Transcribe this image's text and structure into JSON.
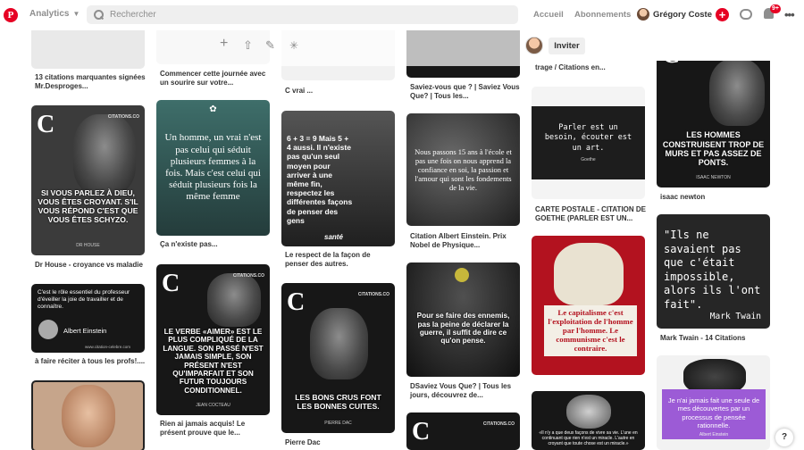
{
  "header": {
    "logo": "P",
    "analytics_label": "Analytics",
    "search_placeholder": "Rechercher",
    "nav_home": "Accueil",
    "nav_following": "Abonnements",
    "user_name": "Grégory Coste",
    "notification_badge": "9+",
    "more": "•••"
  },
  "toolbar": {
    "invite_label": "Inviter"
  },
  "colors": {
    "brand_red": "#e60023",
    "header_grey": "#efefef"
  },
  "pins": {
    "col1": [
      {
        "caption": "13 citations marquantes signées Mr.Desproges..."
      },
      {
        "quote": "Si vous parlez à Dieu, vous êtes croyant. S'il vous répond c'est que vous êtes schyzo.",
        "logo": "C",
        "site": "CITATIONS.CO",
        "author": "DR HOUSE",
        "caption": "Dr House - croyance vs maladie"
      },
      {
        "quote": "C'est le rôle essentiel du professeur d'éveiller la joie de travailler et de connaître.",
        "author": "Albert Einstein",
        "site": "www.citation-celebre.com",
        "caption": "à faire réciter à tous les profs!...."
      }
    ],
    "col2": [
      {
        "caption": "Commencer cette journée avec un sourire sur votre..."
      },
      {
        "quote": "Un homme, un vrai n'est pas celui qui séduit plusieurs femmes à la fois. Mais c'est celui qui séduit plusieurs fois la même femme",
        "caption": "Ça n'existe pas..."
      },
      {
        "quote": "Le verbe «aimer» est le plus compliqué de la langue. Son passé n'est jamais simple, son présent n'est qu'imparfait et son futur toujours conditionnel.",
        "logo": "C",
        "site": "CITATIONS.CO",
        "author": "JEAN COCTEAU",
        "caption": "Rien ai jamais acquis! Le présent prouve que le..."
      }
    ],
    "col3": [
      {
        "caption": "C vrai ..."
      },
      {
        "quote": "6 + 3 = 9 Mais 5 + 4 aussi. Il n'existe pas qu'un seul moyen pour arriver à une même fin, respectez les différentes façons de penser des gens",
        "brand": "santé",
        "caption": "Le respect de la façon de penser des autres."
      },
      {
        "quote": "Les bons crus font les bonnes cuites.",
        "logo": "C",
        "site": "CITATIONS.CO",
        "author": "PIERRE DAC",
        "caption": "Pierre Dac"
      }
    ],
    "col4": [
      {
        "caption": "Saviez-vous que ? | Saviez Vous Que? | Tous les..."
      },
      {
        "quote": "Nous passons 15 ans à l'école et pas une fois on nous apprend la confiance en soi, la passion et l'amour qui sont les fondements de la vie.",
        "caption": "Citation Albert Einstein. Prix Nobel de Physique..."
      },
      {
        "quote": "Pour se faire des ennemis, pas la peine de déclarer la guerre, il suffit de dire ce qu'on pense.",
        "caption": "DSaviez Vous Que? | Tous les jours, découvrez de..."
      },
      {
        "logo": "C",
        "site": "CITATIONS.CO"
      }
    ],
    "col5": [
      {
        "caption": "trage / Citations en..."
      },
      {
        "quote": "Parler est un besoin, écouter est un art.",
        "author": "Goethe",
        "caption": "CARTE POSTALE - CITATION DE GOETHE (PARLER EST UN..."
      },
      {
        "quote": "Le capitalisme c'est l'exploitation de l'homme par l'homme. Le communisme c'est le contraire."
      },
      {
        "quote": "«Il n'y a que deux façons de vivre sa vie. L'une en continuant que rien n'est un miracle. L'autre en croyant que toute chose est un miracle.»"
      }
    ],
    "col6": [
      {
        "quote": "Les hommes construisent trop de murs et pas assez de ponts.",
        "logo": "C",
        "author": "ISAAC NEWTON",
        "caption": "isaac newton"
      },
      {
        "quote": "\"Ils ne savaient pas que c'était impossible, alors ils l'ont fait\".",
        "author": "Mark Twain",
        "caption": "Mark Twain - 14 Citations"
      },
      {
        "quote": "Je n'ai jamais fait une seule de mes découvertes par un processus de pensée rationnelle.",
        "author": "Albert Einstein"
      }
    ]
  },
  "help_label": "?"
}
